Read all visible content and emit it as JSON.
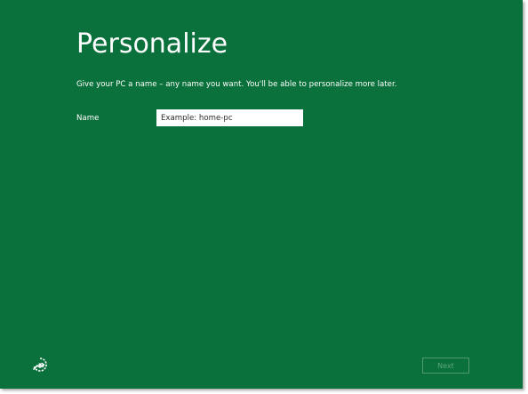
{
  "page": {
    "title": "Personalize",
    "subtitle": "Give your PC a name – any name you want. You'll be able to personalize more later."
  },
  "form": {
    "name_label": "Name",
    "name_value": "",
    "name_placeholder": "Example: home-pc"
  },
  "footer": {
    "next_label": "Next",
    "next_enabled": false,
    "ease_of_access_icon": "ease-of-access-icon"
  },
  "colors": {
    "accent": "#0b713c",
    "text": "#ffffff",
    "input_background": "#ffffff",
    "disabled_button": "#5aa47e"
  }
}
